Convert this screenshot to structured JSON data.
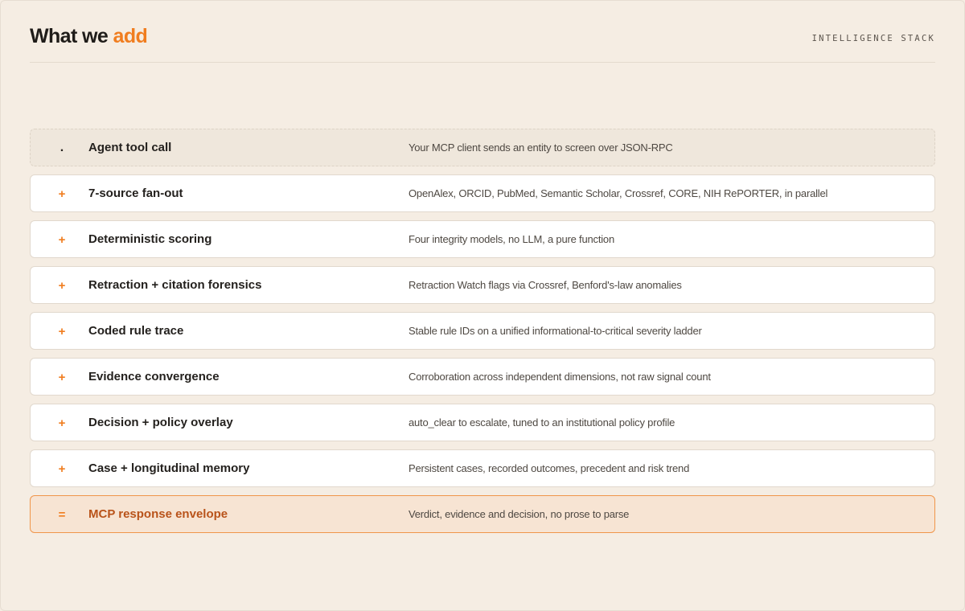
{
  "header": {
    "title_main": "What we ",
    "title_accent": "add",
    "kicker": "INTELLIGENCE STACK"
  },
  "rows": [
    {
      "marker": ".",
      "label": "Agent tool call",
      "desc": "Your MCP client sends an entity to screen over JSON-RPC"
    },
    {
      "marker": "+",
      "label": "7-source fan-out",
      "desc": "OpenAlex, ORCID, PubMed, Semantic Scholar, Crossref, CORE, NIH RePORTER, in parallel"
    },
    {
      "marker": "+",
      "label": "Deterministic scoring",
      "desc": "Four integrity models, no LLM, a pure function"
    },
    {
      "marker": "+",
      "label": "Retraction + citation forensics",
      "desc": "Retraction Watch flags via Crossref, Benford's-law anomalies"
    },
    {
      "marker": "+",
      "label": "Coded rule trace",
      "desc": "Stable rule IDs on a unified informational-to-critical severity ladder"
    },
    {
      "marker": "+",
      "label": "Evidence convergence",
      "desc": "Corroboration across independent dimensions, not raw signal count"
    },
    {
      "marker": "+",
      "label": "Decision + policy overlay",
      "desc": "auto_clear to escalate, tuned to an institutional policy profile"
    },
    {
      "marker": "+",
      "label": "Case + longitudinal memory",
      "desc": "Persistent cases, recorded outcomes, precedent and risk trend"
    },
    {
      "marker": "=",
      "label": "MCP response envelope",
      "desc": "Verdict, evidence and decision, no prose to parse"
    }
  ],
  "colors": {
    "accent": "#f07d1f",
    "background": "#f5ede3",
    "final_row_bg": "#f7e4d3",
    "final_label": "#b9531a"
  }
}
